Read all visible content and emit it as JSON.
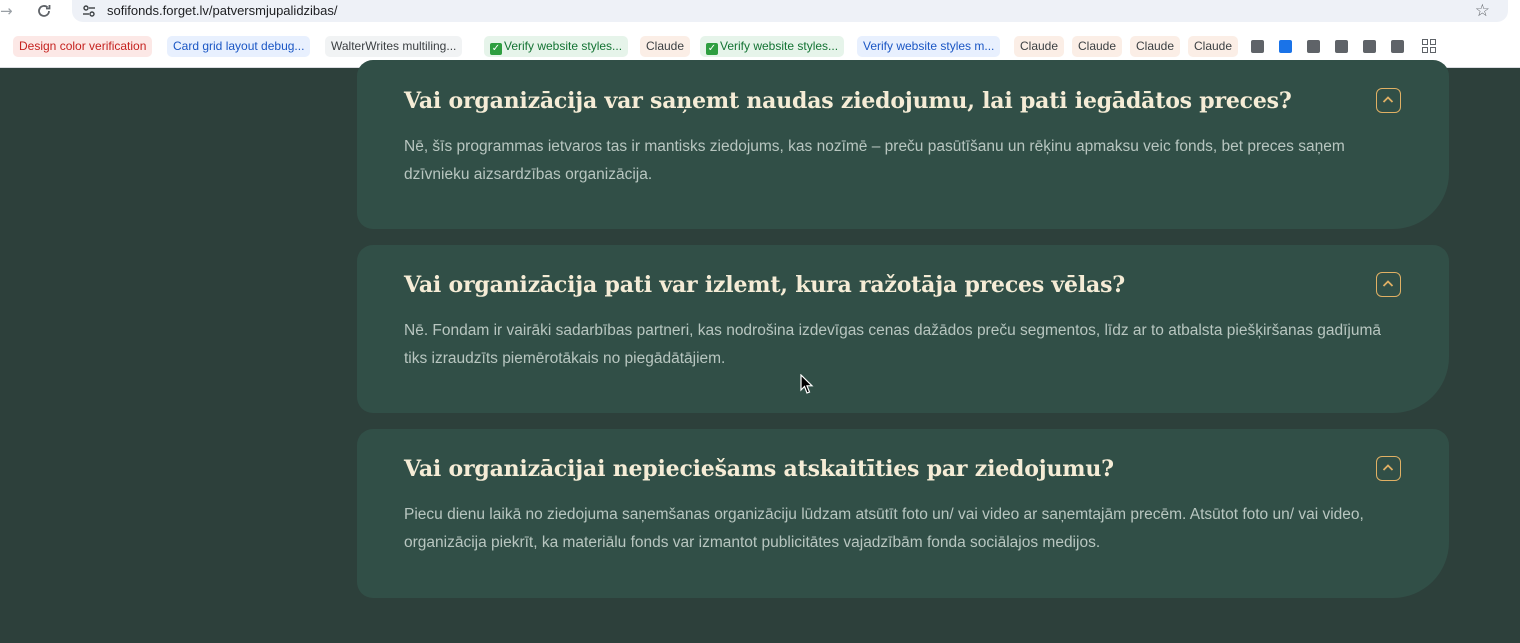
{
  "browser": {
    "url": "sofifonds.forget.lv/patversmjupalidzibas/",
    "bookmarks": [
      {
        "label": "Design color verification",
        "color": "#c5221f",
        "bg": "#fce8e6"
      },
      {
        "label": "Card grid layout debug...",
        "color": "#1a56c4",
        "bg": "#e8f0fe"
      },
      {
        "label": "WalterWrites multiling...",
        "color": "#3c4043",
        "bg": "#f1f3f4"
      },
      {
        "label": "Verify website styles...",
        "color": "#137333",
        "bg": "#e6f4ea",
        "check": true
      },
      {
        "label": "Claude",
        "color": "#3c4043",
        "bg": "#fbeee6"
      },
      {
        "label": "Verify website styles...",
        "color": "#137333",
        "bg": "#e6f4ea",
        "check": true
      },
      {
        "label": "Verify website styles m...",
        "color": "#1a56c4",
        "bg": "#e8f0fe"
      },
      {
        "label": "Claude",
        "color": "#3c4043",
        "bg": "#fbeee6"
      },
      {
        "label": "Claude",
        "color": "#3c4043",
        "bg": "#fbeee6"
      },
      {
        "label": "Claude",
        "color": "#3c4043",
        "bg": "#fbeee6"
      },
      {
        "label": "Claude",
        "color": "#3c4043",
        "bg": "#fbeee6"
      }
    ]
  },
  "faq": [
    {
      "question": "Vai organizācija var saņemt naudas ziedojumu, lai pati iegādātos preces?",
      "answer": "Nē, šīs programmas ietvaros tas ir mantisks ziedojums, kas nozīmē – preču pasūtīšanu un rēķinu apmaksu veic fonds, bet preces saņem dzīvnieku aizsardzības organizācija."
    },
    {
      "question": "Vai organizācija pati var izlemt, kura ražotāja preces vēlas?",
      "answer": "Nē. Fondam ir vairāki sadarbības partneri, kas nodrošina izdevīgas cenas dažādos preču segmentos, līdz ar to atbalsta piešķiršanas gadījumā tiks izraudzīts piemērotākais no piegādātājiem."
    },
    {
      "question": "Vai organizācijai nepieciešams atskaitīties par ziedojumu?",
      "answer": "Piecu dienu laikā no ziedojuma saņemšanas organizāciju lūdzam atsūtīt foto un/ vai video ar saņemtajām precēm. Atsūtot foto un/ vai video, organizācija piekrīt, ka materiālu fonds var izmantot publicitātes vajadzībām fonda sociālajos medijos."
    }
  ],
  "colors": {
    "page_bg": "#2d403b",
    "card_bg": "#314f47",
    "question": "#f5ecd6",
    "answer": "#b8c6c0",
    "accent": "#e0b064"
  }
}
